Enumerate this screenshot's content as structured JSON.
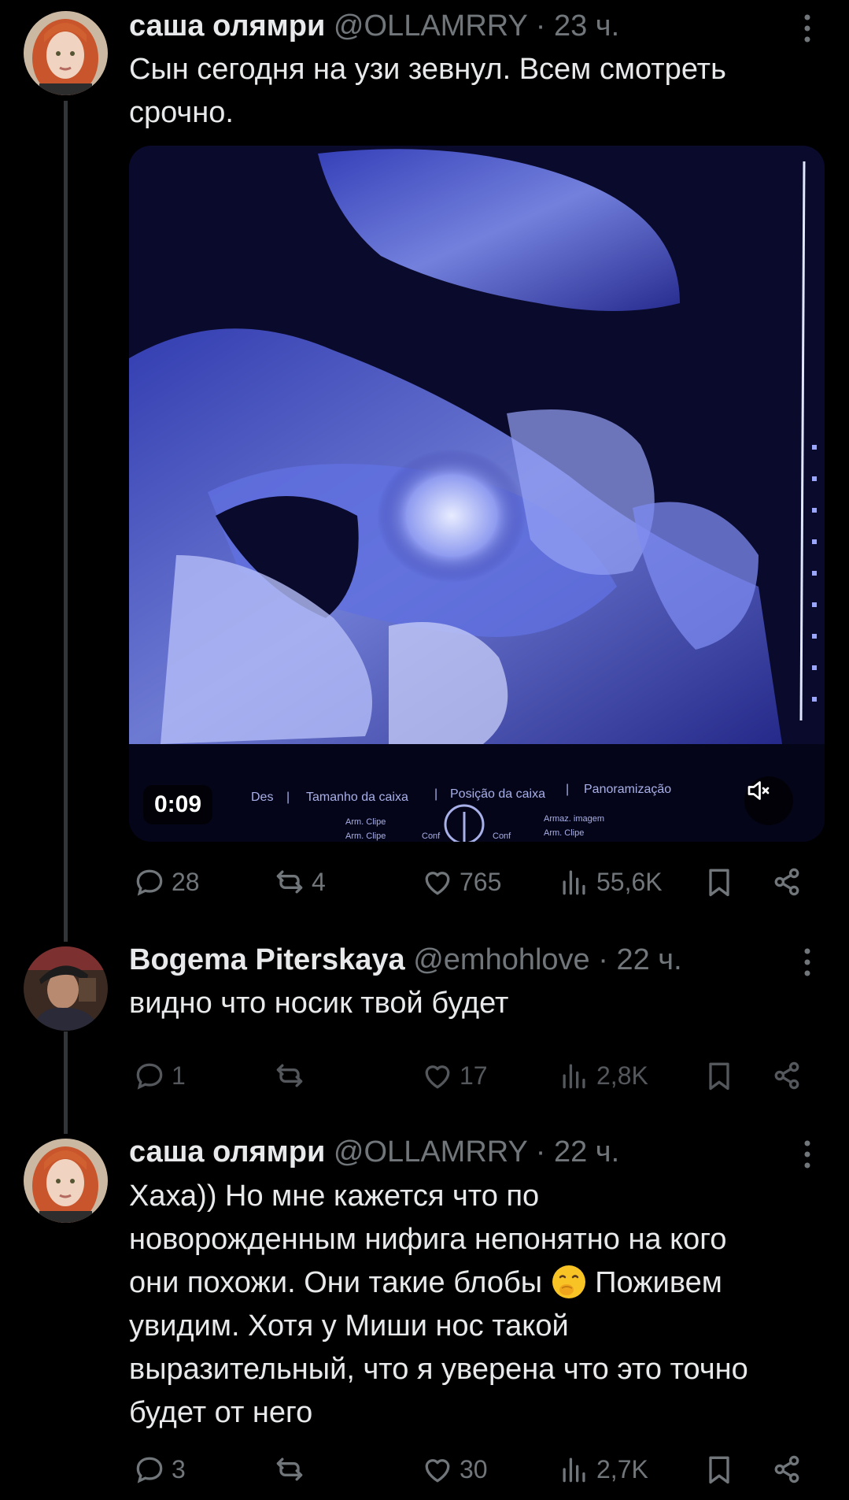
{
  "posts": [
    {
      "name": "саша олямри",
      "handle": "@OLLAMRRY",
      "separator": "·",
      "time": "23 ч.",
      "text_lines": [
        "Сын сегодня на узи зевнул. Всем смотреть",
        "срочно."
      ],
      "video": {
        "duration": "0:09",
        "overlay_text": [
          "Des",
          "|",
          "Tamanho da caixa",
          "|",
          "Posição da caixa",
          "|",
          "Panoramização"
        ],
        "overlay_small_text": [
          "Arm. Clipe",
          "Arm. Clipe",
          "Conf",
          "Conf",
          "Armaz. imagem",
          "Arm. Clipe"
        ]
      },
      "stats": {
        "replies": "28",
        "reposts": "4",
        "likes": "765",
        "views": "55,6K"
      }
    },
    {
      "name": "Bogema Piterskaya",
      "handle": "@emhohlove",
      "separator": "·",
      "time": "22 ч.",
      "text_lines": [
        "видно что носик твой будет"
      ],
      "stats": {
        "replies": "1",
        "reposts": "",
        "likes": "17",
        "views": "2,8K"
      }
    },
    {
      "name": "саша олямри",
      "handle": "@OLLAMRRY",
      "separator": "·",
      "time": "22 ч.",
      "text_lines": [
        "Хаха)) Но мне кажется что по",
        "новорожденным нифига непонятно на кого",
        "они похожи. Они такие блобы",
        " Поживем",
        "увидим. Хотя у Миши нос такой",
        "выразительный, что я уверена что это точно",
        "будет от него"
      ],
      "stats": {
        "replies": "3",
        "reposts": "",
        "likes": "30",
        "views": "2,7K"
      }
    }
  ],
  "icons": {
    "reply": "reply-icon",
    "repost": "repost-icon",
    "like": "heart-icon",
    "views": "views-icon",
    "bookmark": "bookmark-icon",
    "share": "share-icon",
    "more": "more-icon",
    "mute": "mute-icon"
  },
  "colors": {
    "background": "#000000",
    "text": "#e7e9ea",
    "secondary": "#71767b",
    "thread_line": "#333639"
  }
}
